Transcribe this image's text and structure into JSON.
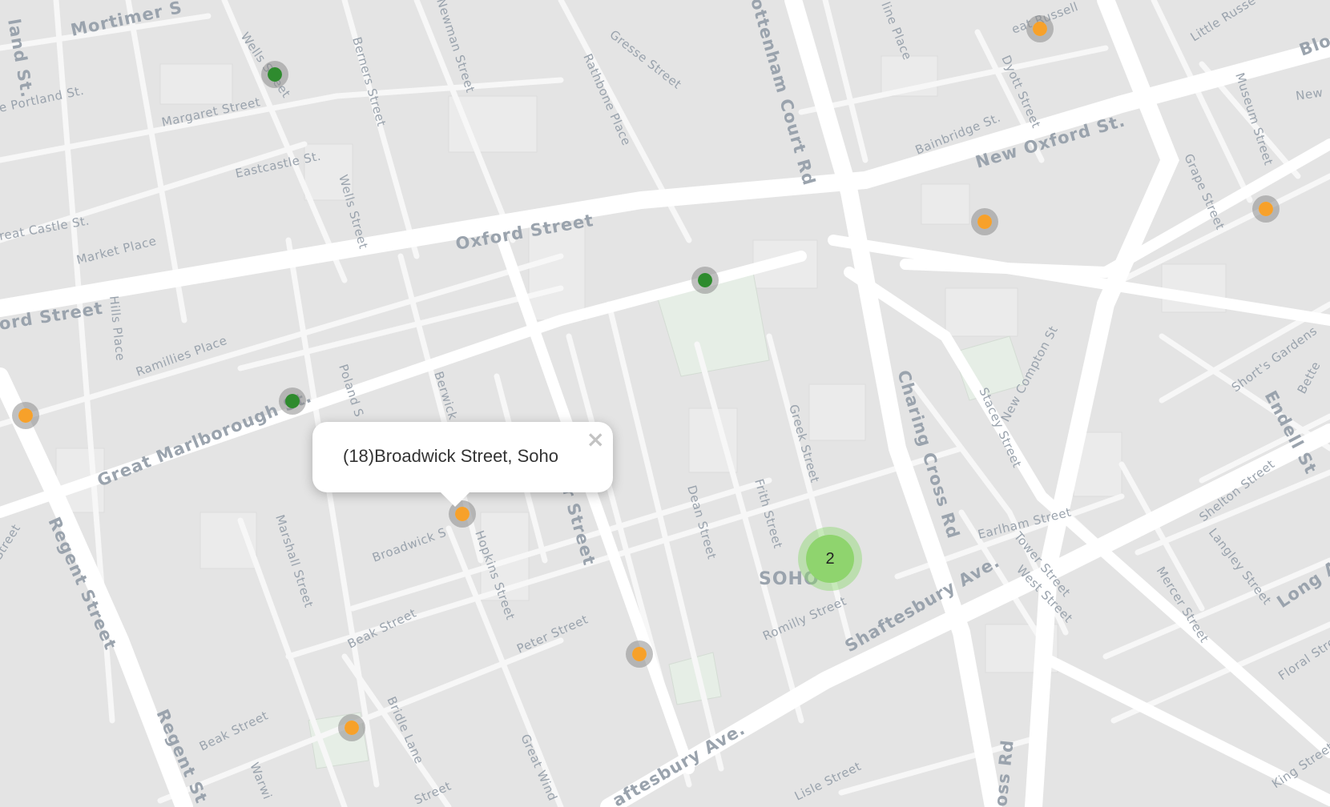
{
  "map": {
    "area_label": "SOHO",
    "street_labels": [
      {
        "id": "oxford-street",
        "text": "Oxford Street"
      },
      {
        "id": "oxford-street-west",
        "text": "ord Street"
      },
      {
        "id": "new-oxford-st",
        "text": "New Oxford St."
      },
      {
        "id": "tottenham-court-rd",
        "text": "ottenham Court Rd"
      },
      {
        "id": "charing-cross-rd",
        "text": "Charing Cross Rd"
      },
      {
        "id": "shaftesbury-ave",
        "text": "Shaftesbury Ave."
      },
      {
        "id": "shaftesbury-ave-2",
        "text": "aftesbury Ave."
      },
      {
        "id": "regent-street",
        "text": "Regent Street"
      },
      {
        "id": "regent-street-2",
        "text": "Regent St"
      },
      {
        "id": "great-marlborough-st",
        "text": "Great Marlborough St."
      },
      {
        "id": "mortimer-st",
        "text": "Mortimer S"
      },
      {
        "id": "margaret-street",
        "text": "Margaret Street"
      },
      {
        "id": "eastcastle-st",
        "text": "Eastcastle St."
      },
      {
        "id": "market-place",
        "text": "Market Place"
      },
      {
        "id": "great-castle-st",
        "text": "reat Castle St."
      },
      {
        "id": "portland-st",
        "text": "e Portland St."
      },
      {
        "id": "ramillies-place",
        "text": "Ramillies Place"
      },
      {
        "id": "hills-place",
        "text": "Hills Place"
      },
      {
        "id": "wells-street",
        "text": "Wells Street"
      },
      {
        "id": "wells-street-2",
        "text": "Wells Street"
      },
      {
        "id": "berners-street",
        "text": "Berners Street"
      },
      {
        "id": "newman-street",
        "text": "Newman Street"
      },
      {
        "id": "rathbone-place",
        "text": "Rathbone Place"
      },
      {
        "id": "gresse-street",
        "text": "Gresse Street"
      },
      {
        "id": "bainbridge-st",
        "text": "Bainbridge St."
      },
      {
        "id": "dyott-street",
        "text": "Dyott Street"
      },
      {
        "id": "museum-street",
        "text": "Museum Street"
      },
      {
        "id": "grape-street",
        "text": "Grape Street"
      },
      {
        "id": "little-russell",
        "text": "Little Russe"
      },
      {
        "id": "great-russell",
        "text": "eat Russell"
      },
      {
        "id": "new-compton-st",
        "text": "New Compton St"
      },
      {
        "id": "stacey-street",
        "text": "Stacey Street"
      },
      {
        "id": "earlham-street",
        "text": "Earlham Street"
      },
      {
        "id": "tower-street",
        "text": "Tower Street"
      },
      {
        "id": "west-street",
        "text": "West Street"
      },
      {
        "id": "mercer-street",
        "text": "Mercer Street"
      },
      {
        "id": "langley-street",
        "text": "Langley Street"
      },
      {
        "id": "shelton-street",
        "text": "Shelton Street"
      },
      {
        "id": "shorts-gardens",
        "text": "Short's Gardens"
      },
      {
        "id": "endell-st",
        "text": "Endell St"
      },
      {
        "id": "long-a",
        "text": "Long A"
      },
      {
        "id": "floral-street",
        "text": "Floral Street"
      },
      {
        "id": "king-street",
        "text": "King Street"
      },
      {
        "id": "greek-street",
        "text": "Greek Street"
      },
      {
        "id": "frith-street",
        "text": "Frith Street"
      },
      {
        "id": "dean-street",
        "text": "Dean Street"
      },
      {
        "id": "wardour-street",
        "text": "r Street"
      },
      {
        "id": "berwick-street",
        "text": "Berwick"
      },
      {
        "id": "poland-street",
        "text": "Poland S"
      },
      {
        "id": "broadwick-street",
        "text": "Broadwick S"
      },
      {
        "id": "hopkins-street",
        "text": "Hopkins Street"
      },
      {
        "id": "peter-street",
        "text": "Peter Street"
      },
      {
        "id": "romilly-street",
        "text": "Romilly Street"
      },
      {
        "id": "marshall-street",
        "text": "Marshall Street"
      },
      {
        "id": "beak-street",
        "text": "Beak Street"
      },
      {
        "id": "beak-street-2",
        "text": "Beak Street"
      },
      {
        "id": "bridle-lane",
        "text": "Bridle Lane"
      },
      {
        "id": "great-windmill",
        "text": "Great Wind"
      },
      {
        "id": "lisle-street",
        "text": "Lisle Street"
      },
      {
        "id": "charing-cross-rd-2",
        "text": "oss Rd"
      },
      {
        "id": "land-st",
        "text": "land St."
      },
      {
        "id": "warwick",
        "text": "Warwi"
      },
      {
        "id": "street-left",
        "text": "Street"
      },
      {
        "id": "street-bottom",
        "text": "Street"
      },
      {
        "id": "blo",
        "text": "Blo"
      },
      {
        "id": "new-top-right",
        "text": "New"
      },
      {
        "id": "bette",
        "text": "Bette"
      },
      {
        "id": "line-place",
        "text": "line Place"
      }
    ],
    "markers": [
      {
        "color": "green",
        "icon": "green-marker"
      },
      {
        "color": "orange",
        "icon": "orange-marker"
      },
      {
        "color": "orange",
        "icon": "orange-marker"
      },
      {
        "color": "orange",
        "icon": "orange-marker"
      },
      {
        "color": "green",
        "icon": "green-marker"
      },
      {
        "color": "orange",
        "icon": "orange-marker"
      },
      {
        "color": "green",
        "icon": "green-marker"
      },
      {
        "color": "orange",
        "icon": "orange-marker"
      },
      {
        "color": "orange",
        "icon": "orange-marker"
      },
      {
        "color": "orange",
        "icon": "orange-marker"
      }
    ],
    "cluster": {
      "count": "2",
      "color": "#8fd46e"
    },
    "popup": {
      "text": "(18)Broadwick Street, Soho",
      "close_label": "×"
    },
    "colors": {
      "background": "#e4e4e4",
      "road": "#ffffff",
      "label": "#9aa3ad",
      "marker_orange": "#f7a12a",
      "marker_green": "#2e8b2e",
      "park": "#e6eee6"
    }
  }
}
